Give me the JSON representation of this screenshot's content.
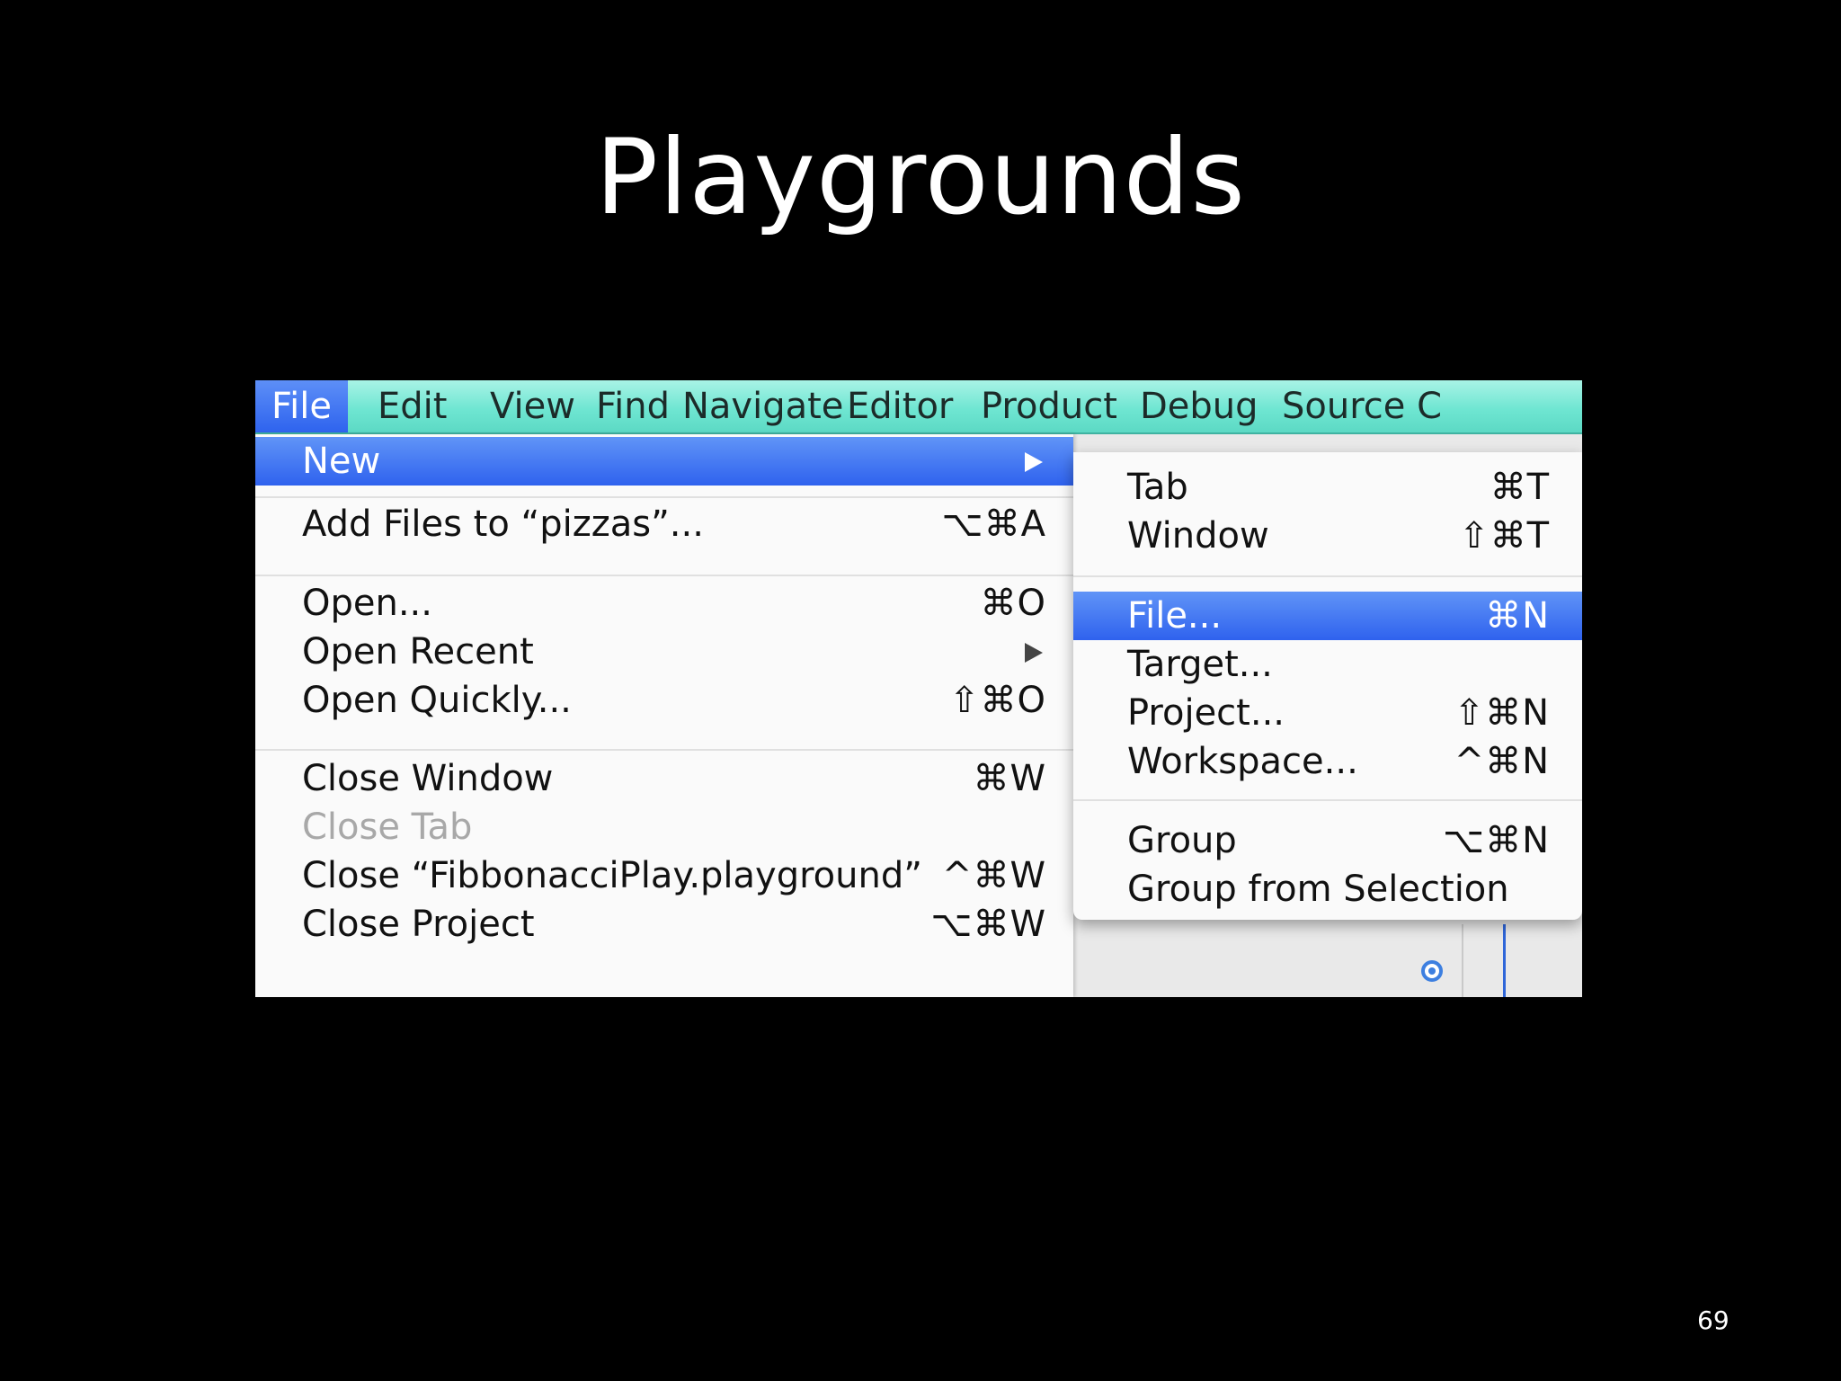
{
  "slide": {
    "title": "Playgrounds",
    "number": "69"
  },
  "menubar": {
    "items": [
      "File",
      "Edit",
      "View",
      "Find",
      "Navigate",
      "Editor",
      "Product",
      "Debug",
      "Source C"
    ],
    "active": "File"
  },
  "file_menu": {
    "items": [
      {
        "label": "New",
        "shortcut": "",
        "submenu": true,
        "highlighted": true
      },
      {
        "label": "Add Files to “pizzas”...",
        "shortcut": "⌥⌘A"
      },
      {
        "label": "Open...",
        "shortcut": "⌘O"
      },
      {
        "label": "Open Recent",
        "shortcut": "",
        "submenu": true
      },
      {
        "label": "Open Quickly...",
        "shortcut": "⇧⌘O"
      },
      {
        "label": "Close Window",
        "shortcut": "⌘W"
      },
      {
        "label": "Close Tab",
        "shortcut": "",
        "disabled": true
      },
      {
        "label": "Close “FibbonacciPlay.playground”",
        "shortcut": "^⌘W"
      },
      {
        "label": "Close Project",
        "shortcut": "⌥⌘W"
      }
    ]
  },
  "new_submenu": {
    "items": [
      {
        "label": "Tab",
        "shortcut": "⌘T"
      },
      {
        "label": "Window",
        "shortcut": "⇧⌘T"
      },
      {
        "label": "File...",
        "shortcut": "⌘N",
        "highlighted": true
      },
      {
        "label": "Target...",
        "shortcut": ""
      },
      {
        "label": "Project...",
        "shortcut": "⇧⌘N"
      },
      {
        "label": "Workspace...",
        "shortcut": "^⌘N"
      },
      {
        "label": "Group",
        "shortcut": "⌥⌘N"
      },
      {
        "label": "Group from Selection",
        "shortcut": ""
      }
    ]
  },
  "colors": {
    "menubar": "#6fe6d2",
    "highlight": "#2f62ee",
    "background": "#000000"
  }
}
